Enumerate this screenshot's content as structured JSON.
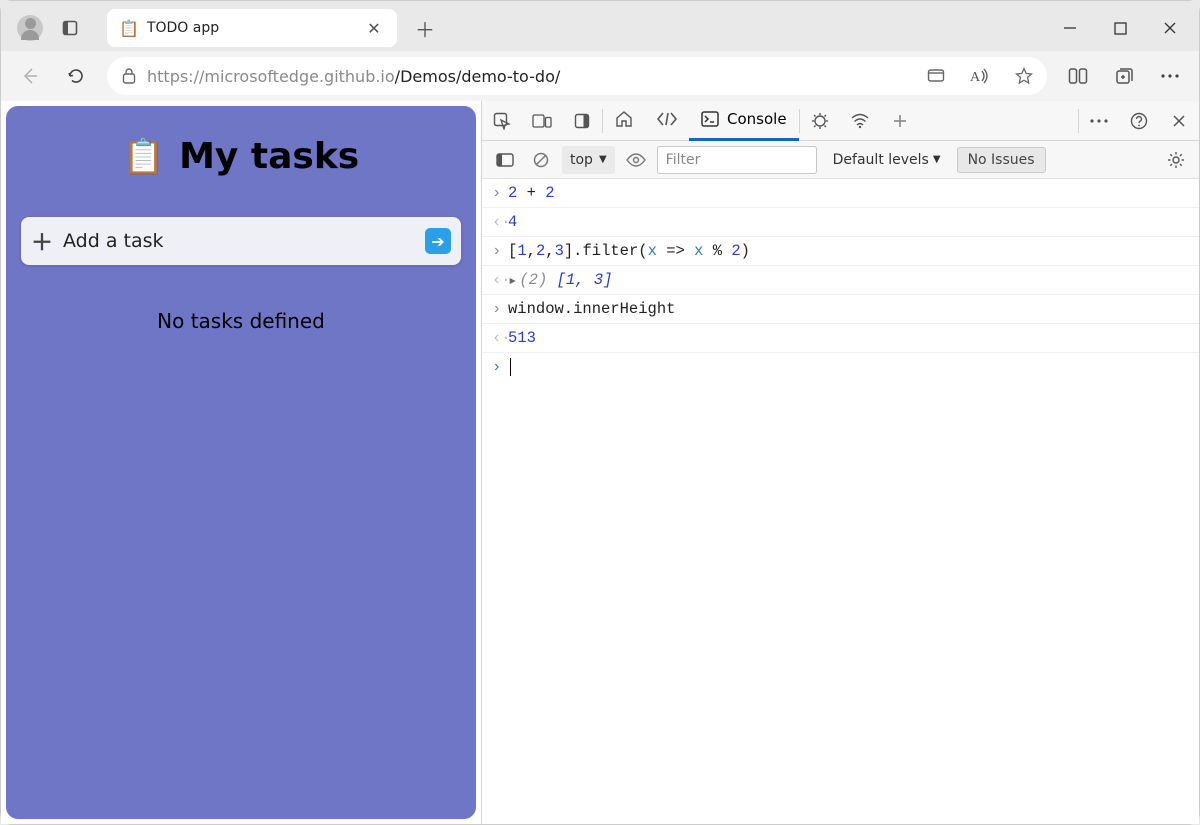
{
  "tab": {
    "title": "TODO app",
    "favicon": "📋"
  },
  "address": {
    "host": "https://microsoftedge.github.io",
    "path": "/Demos/demo-to-do/"
  },
  "page": {
    "heading_icon": "📋",
    "heading": "My tasks",
    "add_placeholder": "Add a task",
    "empty": "No tasks defined"
  },
  "devtools": {
    "tabs": {
      "console": "Console"
    },
    "toolbar": {
      "context": "top",
      "filter_placeholder": "Filter",
      "levels": "Default levels",
      "issues": "No Issues"
    },
    "console": {
      "line1_a": "2",
      "line1_b": " + ",
      "line1_c": "2",
      "out1": "4",
      "line2_a": "[",
      "line2_b": "1",
      "line2_c": ",",
      "line2_d": "2",
      "line2_e": ",",
      "line2_f": "3",
      "line2_g": "].filter(",
      "line2_h": "x",
      "line2_i": " => ",
      "line2_j": "x",
      "line2_k": " % ",
      "line2_l": "2",
      "line2_m": ")",
      "out2_count": "(2) ",
      "out2_arr": "[1, 3]",
      "line3": "window.innerHeight",
      "out3": "513"
    }
  }
}
